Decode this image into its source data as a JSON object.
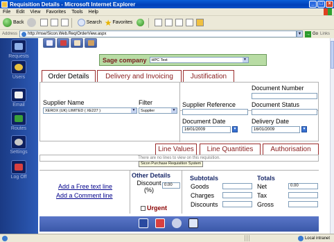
{
  "window": {
    "title": "Requisition Details - Microsoft Internet Explorer",
    "controls": [
      "_",
      "□",
      "×"
    ]
  },
  "menu": [
    "File",
    "Edit",
    "View",
    "Favorites",
    "Tools",
    "Help"
  ],
  "toolbar": {
    "back": "Back",
    "search": "Search",
    "favorites": "Favorites"
  },
  "address": {
    "label": "Address",
    "url": "http://mse/Sicon.Web.Req/OrderView.aspx",
    "go": "Go",
    "links": "Links"
  },
  "sidebar": {
    "items": [
      {
        "label": "Requests",
        "icon": "requests-icon"
      },
      {
        "label": "Users",
        "icon": "users-icon"
      },
      {
        "label": "Email",
        "icon": "email-icon"
      },
      {
        "label": "Routes",
        "icon": "routes-icon"
      },
      {
        "label": "Settings",
        "icon": "settings-icon"
      },
      {
        "label": "Log Off",
        "icon": "logoff-icon"
      }
    ]
  },
  "company": {
    "label": "Sage company",
    "value": "HPC Test"
  },
  "tabs": [
    "Order Details",
    "Delivery and Invoicing",
    "Justification"
  ],
  "order": {
    "supplier_name_label": "Supplier Name",
    "supplier_value": "XEROX (UK) LIMITED ( XE227 )",
    "filter_label": "Filter",
    "filter_value": "Supplier",
    "document_number_label": "Document Number",
    "supplier_reference_label": "Supplier Reference",
    "document_status_label": "Document Status",
    "document_date_label": "Document Date",
    "document_date_value": "16/01/2009",
    "delivery_date_label": "Delivery Date",
    "delivery_date_value": "16/01/2009"
  },
  "line_tabs": [
    "Line Values",
    "Line Quantities",
    "Authorisation"
  ],
  "lines": {
    "empty_message": "There are no lines to view on this requisition.",
    "tooltip": "Sicon Purchase Requisition System"
  },
  "bottom": {
    "add_free_text": "Add a Free text line",
    "add_comment": "Add a Comment line",
    "other_details_title": "Other Details",
    "discount_label": "Discount (%)",
    "discount_value": "0.00",
    "urgent_label": "Urgent",
    "subtotals_title": "Subtotals",
    "goods_label": "Goods",
    "charges_label": "Charges",
    "discounts_label": "Discounts",
    "totals_title": "Totals",
    "net_label": "Net",
    "net_value": "0.00",
    "tax_label": "Tax",
    "gross_label": "Gross"
  },
  "status": {
    "zone": "Local intranet"
  }
}
